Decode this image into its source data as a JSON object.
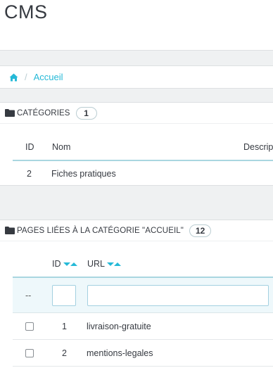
{
  "page": {
    "title": "CMS"
  },
  "breadcrumb": {
    "home_icon": "home-icon",
    "separator": "/",
    "current": "Accueil"
  },
  "categories_panel": {
    "title": "Catégories",
    "count": "1",
    "columns": [
      "ID",
      "Nom",
      "Descrip"
    ],
    "rows": [
      {
        "id": "2",
        "name": "Fiches pratiques"
      }
    ]
  },
  "pages_panel": {
    "title": "Pages liées à la catégorie \"Accueil\"",
    "count": "12",
    "columns": {
      "id": "ID",
      "url": "URL"
    },
    "filter": {
      "bulk_placeholder": "--",
      "id_value": "",
      "url_value": ""
    },
    "rows": [
      {
        "id": "1",
        "url": "livraison-gratuite"
      },
      {
        "id": "2",
        "url": "mentions-legales"
      }
    ]
  },
  "colors": {
    "accent": "#25b9d7",
    "text": "#363a41",
    "background": "#eff1f2"
  }
}
